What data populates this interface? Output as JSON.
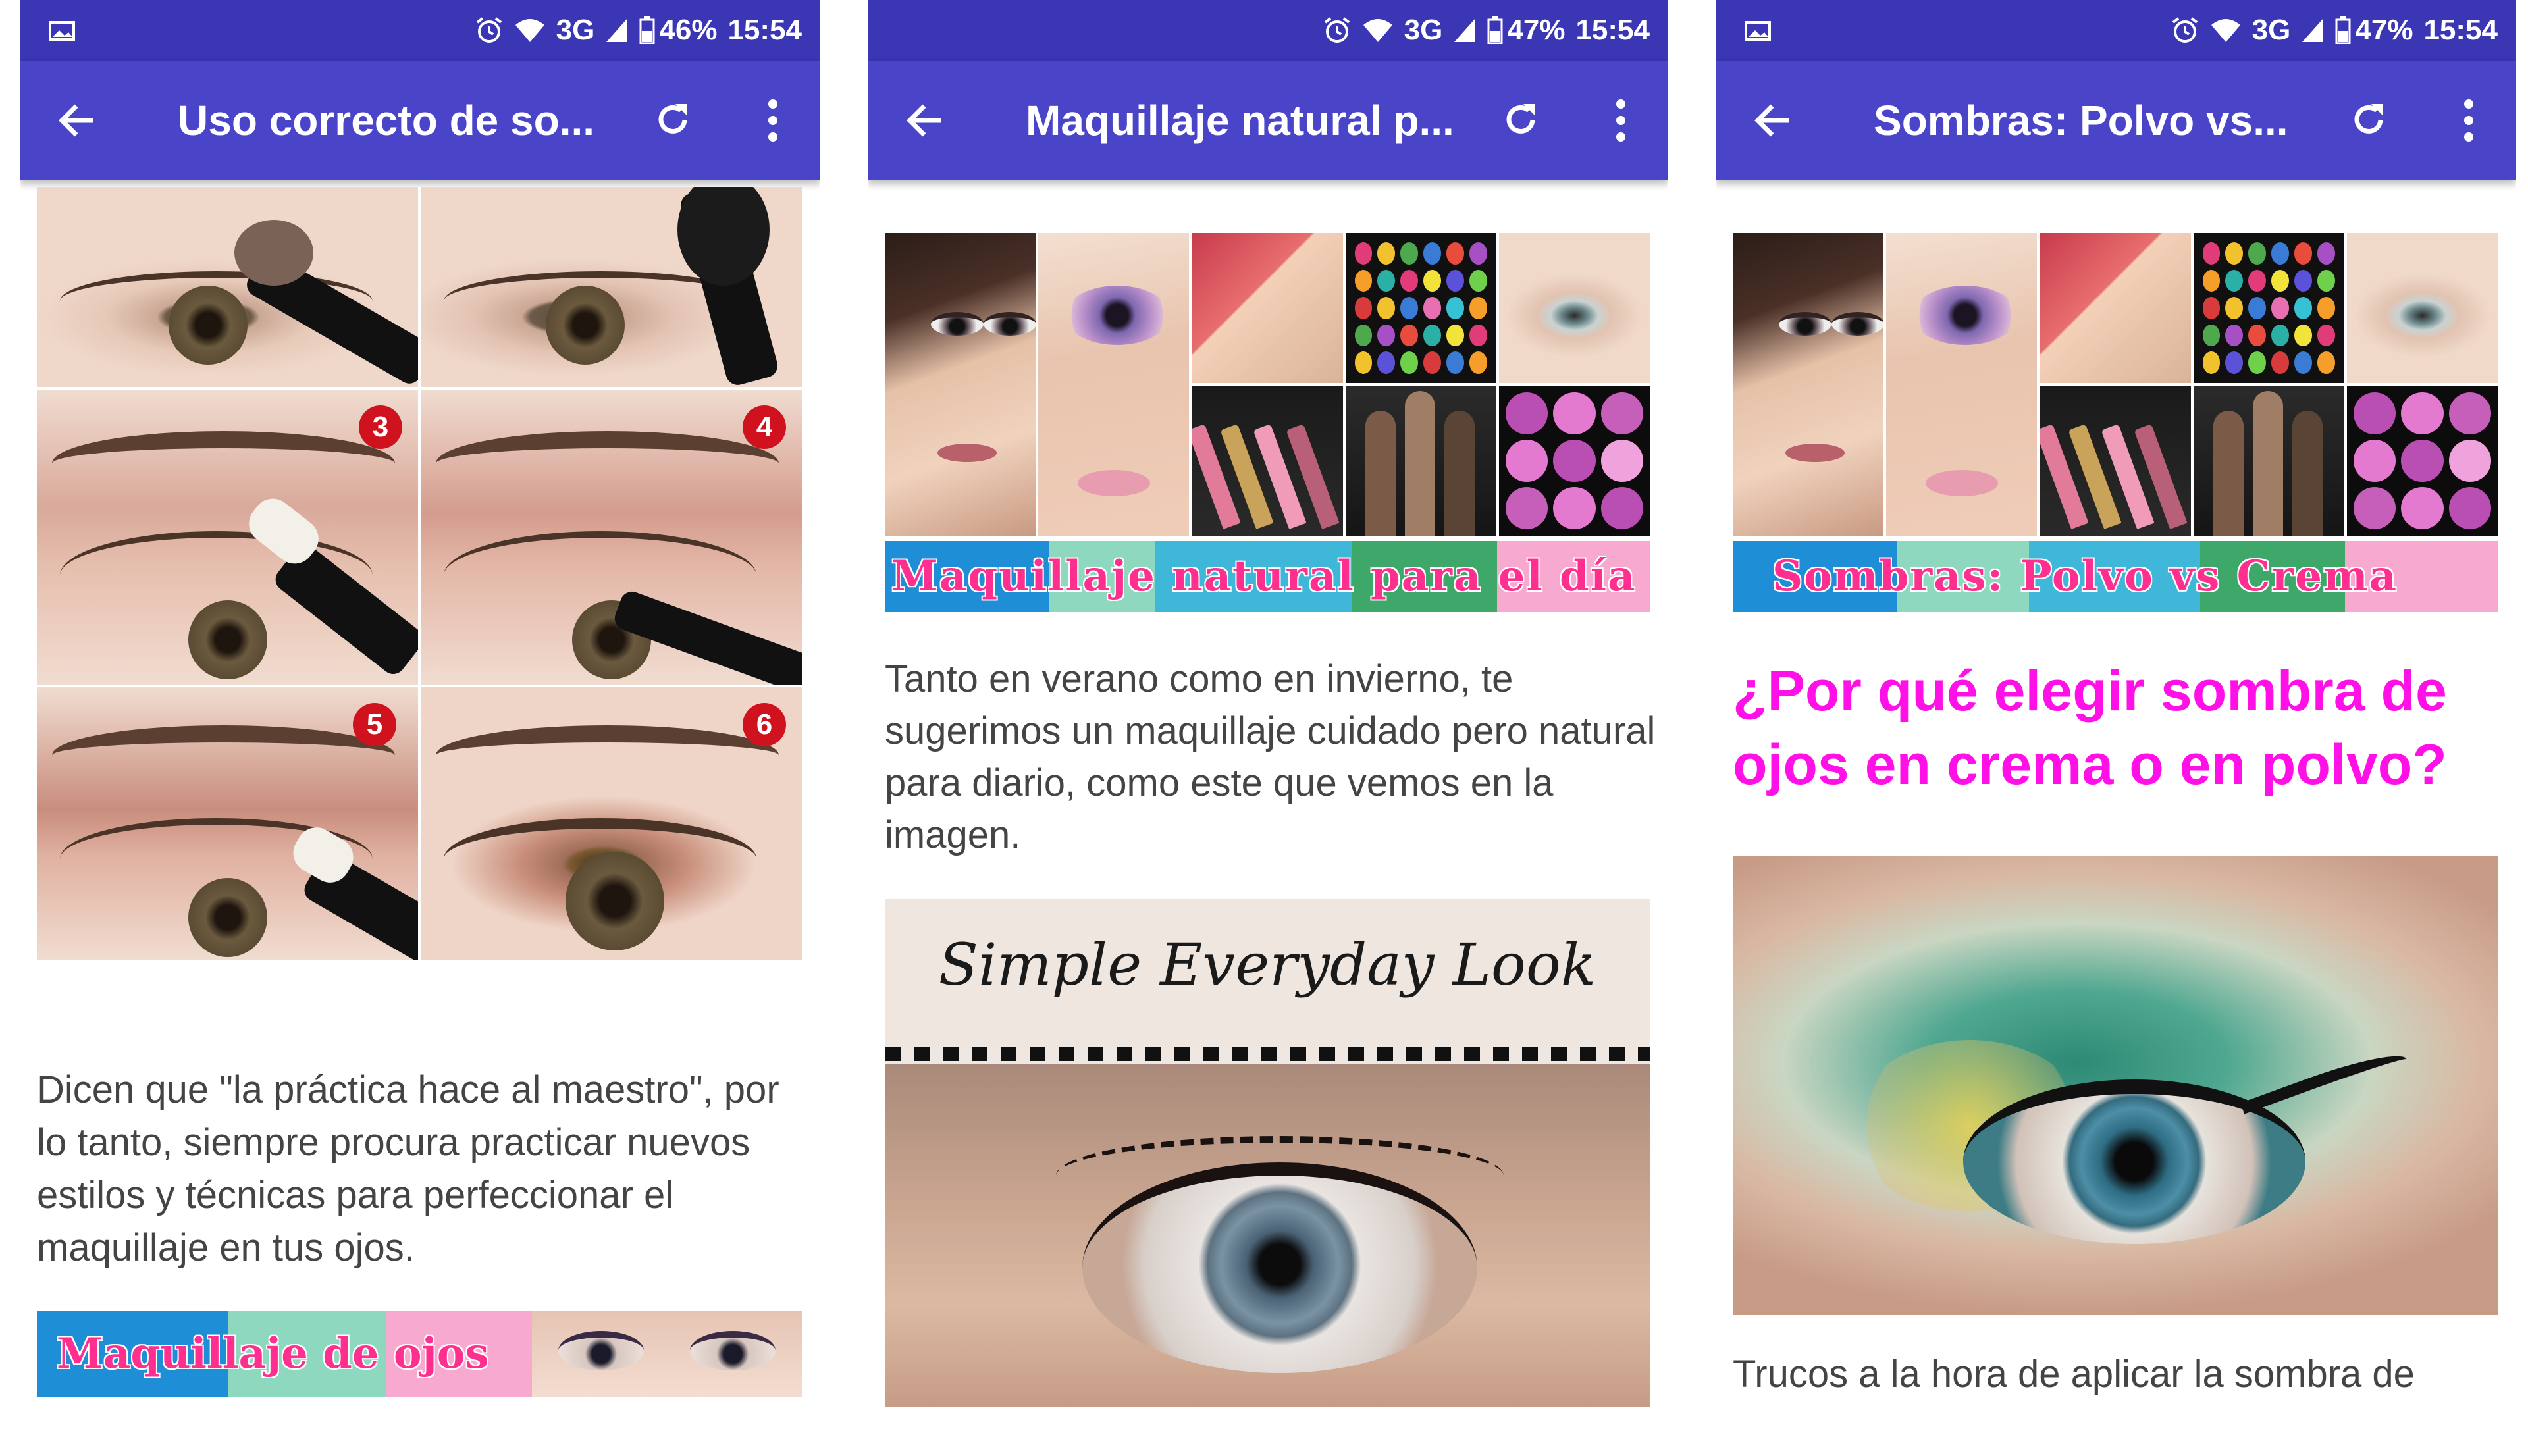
{
  "colors": {
    "status_bar": "#3a36b4",
    "app_bar": "#4a45c8",
    "heading_magenta": "#ff10e6",
    "banner_text_pink": "#ff2f8f",
    "banner_blue": "#1e8fd6",
    "banner_mint": "#8fd8c0",
    "banner_pink": "#f7a9cf",
    "step_badge": "#d0121e"
  },
  "screens": [
    {
      "status": {
        "left_icon": "gallery-icon",
        "alarm_icon": "alarm-icon",
        "wifi_icon": "wifi-icon",
        "network": "3G",
        "signal_icon": "signal-icon",
        "battery_icon": "battery-icon",
        "battery": "46%",
        "time": "15:54"
      },
      "app_bar": {
        "back_icon": "arrow-back-icon",
        "title": "Uso correcto de so...",
        "refresh_icon": "refresh-icon",
        "more_icon": "more-vert-icon"
      },
      "step_badges": [
        "3",
        "4",
        "5",
        "6"
      ],
      "body_text": "Dicen que \"la práctica hace al maestro\", por lo tanto, siempre procura practicar nuevos estilos y técnicas para perfeccionar el maquillaje en tus ojos.",
      "banner_text": "Maquillaje de ojos"
    },
    {
      "status": {
        "left_icon": "gallery-icon",
        "alarm_icon": "alarm-icon",
        "wifi_icon": "wifi-icon",
        "network": "3G",
        "signal_icon": "signal-icon",
        "battery_icon": "battery-icon",
        "battery": "47%",
        "time": "15:54"
      },
      "app_bar": {
        "back_icon": "arrow-back-icon",
        "title": "Maquillaje natural p...",
        "refresh_icon": "refresh-icon",
        "more_icon": "more-vert-icon"
      },
      "banner_text": "Maquillaje natural para el día",
      "body_text": "Tanto en verano como en invierno, te sugerimos un maquillaje cuidado pero natural para diario, como este que vemos en la imagen.",
      "photo_caption": "Simple Everyday Look"
    },
    {
      "status": {
        "left_icon": "gallery-icon",
        "alarm_icon": "alarm-icon",
        "wifi_icon": "wifi-icon",
        "network": "3G",
        "signal_icon": "signal-icon",
        "battery_icon": "battery-icon",
        "battery": "47%",
        "time": "15:54"
      },
      "app_bar": {
        "back_icon": "arrow-back-icon",
        "title": "Sombras: Polvo vs...",
        "refresh_icon": "refresh-icon",
        "more_icon": "more-vert-icon"
      },
      "banner_text": "Sombras: Polvo vs Crema",
      "heading": "¿Por qué elegir sombra de ojos en crema o en polvo?",
      "body_text": "Trucos a la hora de aplicar la sombra de"
    }
  ]
}
